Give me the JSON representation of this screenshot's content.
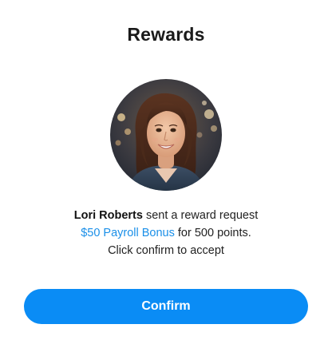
{
  "header": {
    "title": "Rewards"
  },
  "avatar": {
    "alt": "Lori Roberts"
  },
  "message": {
    "sender_name": "Lori Roberts",
    "sender_suffix": " sent a reward request",
    "reward_link": "$50 Payroll Bonus",
    "reward_suffix": " for 500 points.",
    "instruction": "Click confirm to accept"
  },
  "actions": {
    "confirm_label": "Confirm"
  },
  "colors": {
    "accent": "#0a8cf5",
    "link": "#1a8fe8",
    "title_text": "#1a1a1a",
    "background": "#ffffff"
  }
}
